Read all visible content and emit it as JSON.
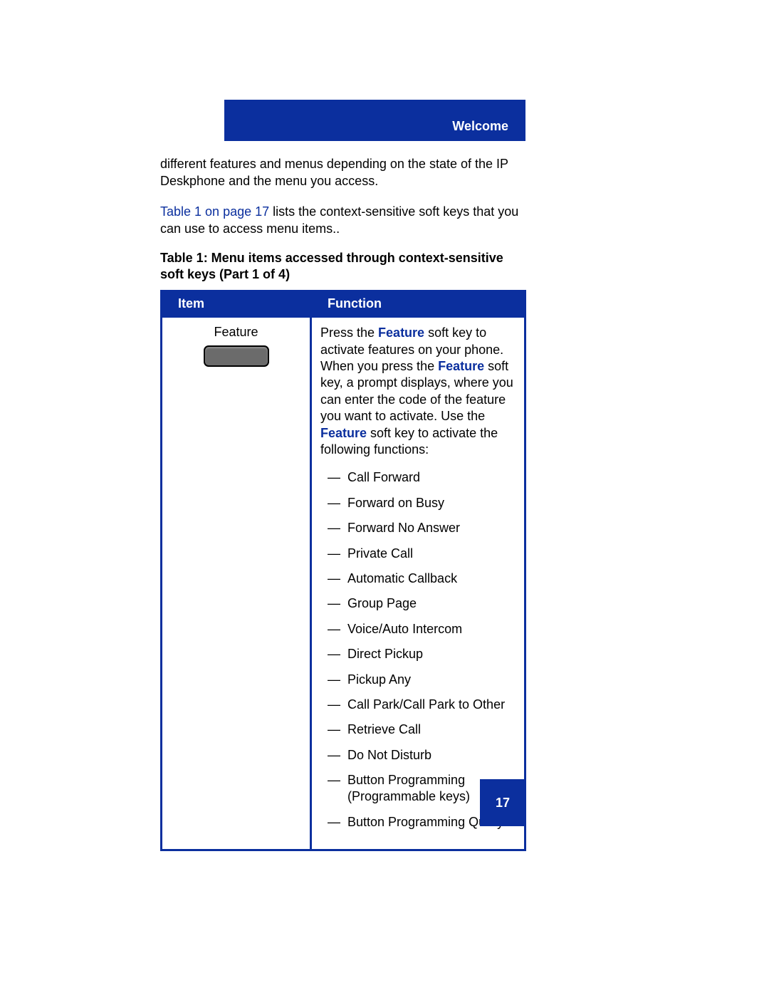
{
  "header": {
    "section_title": "Welcome"
  },
  "paragraphs": {
    "p1": "different features and menus depending on the state of the IP Deskphone and the menu you access.",
    "p2_link": "Table 1 on page 17",
    "p2_rest": " lists the context-sensitive soft keys that you can use to access menu items.."
  },
  "table": {
    "caption": "Table 1: Menu items accessed through context-sensitive soft keys (Part 1 of 4)",
    "headers": {
      "item": "Item",
      "function": "Function"
    },
    "row1": {
      "item_label": "Feature",
      "func_text_segments": {
        "s1": "Press the ",
        "kw1": "Feature",
        "s2": " soft key to activate features on your phone. When you press the ",
        "kw2": "Feature",
        "s3": " soft key, a prompt displays, where you can enter the code of the feature you want to activate. Use the ",
        "kw3": "Feature",
        "s4": " soft key to activate the following functions:"
      },
      "bullets": [
        "Call Forward",
        "Forward on Busy",
        "Forward No Answer",
        "Private Call",
        "Automatic Callback",
        "Group Page",
        "Voice/Auto Intercom",
        "Direct Pickup",
        "Pickup Any",
        "Call Park/Call Park to Other",
        "Retrieve Call",
        "Do Not Disturb",
        "Button Programming (Programmable keys)",
        "Button Programming Query"
      ]
    }
  },
  "page_number": "17"
}
